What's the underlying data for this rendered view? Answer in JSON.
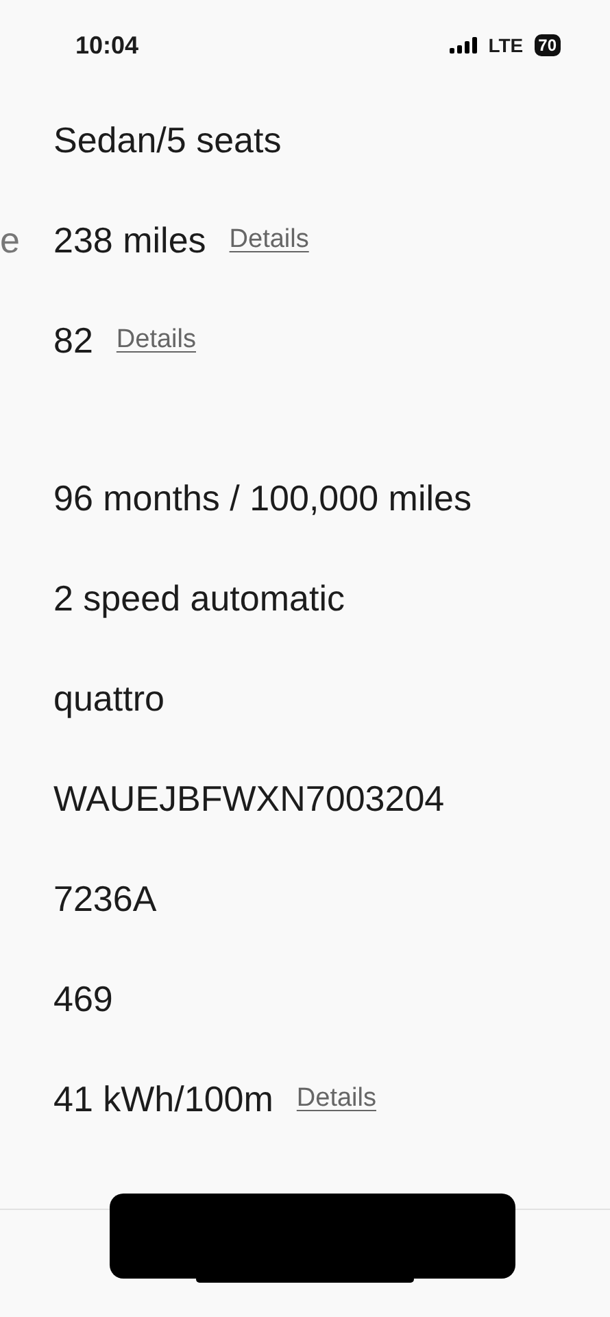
{
  "status_bar": {
    "time": "10:04",
    "network": "LTE",
    "battery": "70"
  },
  "sections": [
    [
      {
        "value": "Sedan/5 seats"
      },
      {
        "label": "e",
        "value": "238 miles",
        "link": "Details"
      },
      {
        "value": "82",
        "link": "Details"
      }
    ],
    [
      {
        "value": "96 months / 100,000 miles"
      },
      {
        "value": "2 speed automatic"
      },
      {
        "value": "quattro"
      },
      {
        "value": "WAUEJBFWXN7003204"
      },
      {
        "value": "7236A"
      },
      {
        "value": "469"
      },
      {
        "value": "41 kWh/100m",
        "link": "Details"
      }
    ]
  ]
}
